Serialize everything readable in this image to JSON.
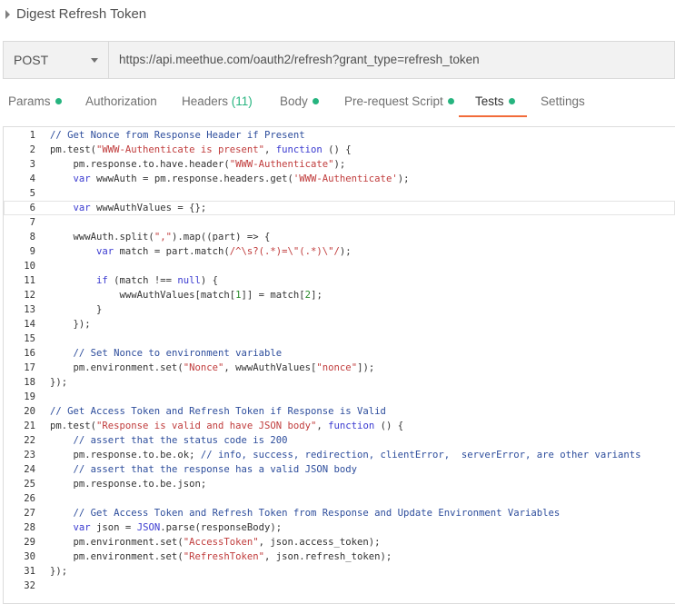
{
  "request": {
    "name": "Digest Refresh Token",
    "method": "POST",
    "url": "https://api.meethue.com/oauth2/refresh?grant_type=refresh_token"
  },
  "tabs": [
    {
      "label": "Params",
      "dot": true
    },
    {
      "label": "Authorization"
    },
    {
      "label": "Headers",
      "count": "(11)"
    },
    {
      "label": "Body",
      "dot": true
    },
    {
      "label": "Pre-request Script",
      "dot": true
    },
    {
      "label": "Tests",
      "dot": true,
      "active": true
    },
    {
      "label": "Settings"
    }
  ],
  "colors": {
    "accent": "#f26b3a",
    "indicator": "#26b47f"
  },
  "code_lines": [
    "// Get Nonce from Response Header if Present",
    "pm.test(\"WWW-Authenticate is present\", function () {",
    "    pm.response.to.have.header(\"WWW-Authenticate\");",
    "    var wwwAuth = pm.response.headers.get('WWW-Authenticate');",
    "",
    "    var wwwAuthValues = {};",
    "",
    "    wwwAuth.split(\",\").map((part) => {",
    "        var match = part.match(/^\\s?(.*)=\\\"(.*)\\\"/);",
    "",
    "        if (match !== null) {",
    "            wwwAuthValues[match[1]] = match[2];",
    "        }",
    "    });",
    "",
    "    // Set Nonce to environment variable",
    "    pm.environment.set(\"Nonce\", wwwAuthValues[\"nonce\"]);",
    "});",
    "",
    "// Get Access Token and Refresh Token if Response is Valid",
    "pm.test(\"Response is valid and have JSON body\", function () {",
    "    // assert that the status code is 200",
    "    pm.response.to.be.ok; // info, success, redirection, clientError,  serverError, are other variants",
    "    // assert that the response has a valid JSON body",
    "    pm.response.to.be.json;",
    "",
    "    // Get Access Token and Refresh Token from Response and Update Environment Variables",
    "    var json = JSON.parse(responseBody);",
    "    pm.environment.set(\"AccessToken\", json.access_token);",
    "    pm.environment.set(\"RefreshToken\", json.refresh_token);",
    "});",
    ""
  ],
  "highlighted_line": 6
}
